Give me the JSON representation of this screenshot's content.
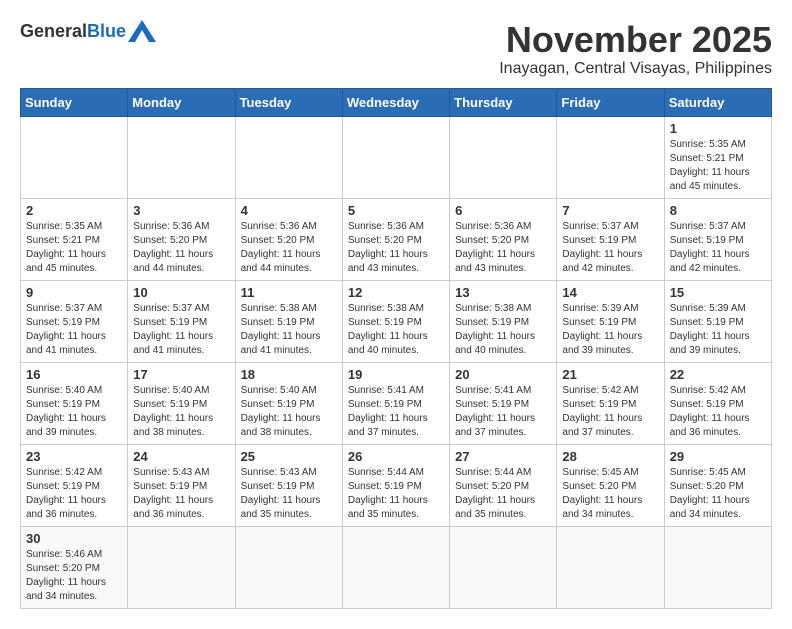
{
  "header": {
    "logo_general": "General",
    "logo_blue": "Blue",
    "month": "November 2025",
    "location": "Inayagan, Central Visayas, Philippines"
  },
  "weekdays": [
    "Sunday",
    "Monday",
    "Tuesday",
    "Wednesday",
    "Thursday",
    "Friday",
    "Saturday"
  ],
  "weeks": [
    [
      {
        "day": "",
        "info": ""
      },
      {
        "day": "",
        "info": ""
      },
      {
        "day": "",
        "info": ""
      },
      {
        "day": "",
        "info": ""
      },
      {
        "day": "",
        "info": ""
      },
      {
        "day": "",
        "info": ""
      },
      {
        "day": "1",
        "info": "Sunrise: 5:35 AM\nSunset: 5:21 PM\nDaylight: 11 hours\nand 45 minutes."
      }
    ],
    [
      {
        "day": "2",
        "info": "Sunrise: 5:35 AM\nSunset: 5:21 PM\nDaylight: 11 hours\nand 45 minutes."
      },
      {
        "day": "3",
        "info": "Sunrise: 5:36 AM\nSunset: 5:20 PM\nDaylight: 11 hours\nand 44 minutes."
      },
      {
        "day": "4",
        "info": "Sunrise: 5:36 AM\nSunset: 5:20 PM\nDaylight: 11 hours\nand 44 minutes."
      },
      {
        "day": "5",
        "info": "Sunrise: 5:36 AM\nSunset: 5:20 PM\nDaylight: 11 hours\nand 43 minutes."
      },
      {
        "day": "6",
        "info": "Sunrise: 5:36 AM\nSunset: 5:20 PM\nDaylight: 11 hours\nand 43 minutes."
      },
      {
        "day": "7",
        "info": "Sunrise: 5:37 AM\nSunset: 5:19 PM\nDaylight: 11 hours\nand 42 minutes."
      },
      {
        "day": "8",
        "info": "Sunrise: 5:37 AM\nSunset: 5:19 PM\nDaylight: 11 hours\nand 42 minutes."
      }
    ],
    [
      {
        "day": "9",
        "info": "Sunrise: 5:37 AM\nSunset: 5:19 PM\nDaylight: 11 hours\nand 41 minutes."
      },
      {
        "day": "10",
        "info": "Sunrise: 5:37 AM\nSunset: 5:19 PM\nDaylight: 11 hours\nand 41 minutes."
      },
      {
        "day": "11",
        "info": "Sunrise: 5:38 AM\nSunset: 5:19 PM\nDaylight: 11 hours\nand 41 minutes."
      },
      {
        "day": "12",
        "info": "Sunrise: 5:38 AM\nSunset: 5:19 PM\nDaylight: 11 hours\nand 40 minutes."
      },
      {
        "day": "13",
        "info": "Sunrise: 5:38 AM\nSunset: 5:19 PM\nDaylight: 11 hours\nand 40 minutes."
      },
      {
        "day": "14",
        "info": "Sunrise: 5:39 AM\nSunset: 5:19 PM\nDaylight: 11 hours\nand 39 minutes."
      },
      {
        "day": "15",
        "info": "Sunrise: 5:39 AM\nSunset: 5:19 PM\nDaylight: 11 hours\nand 39 minutes."
      }
    ],
    [
      {
        "day": "16",
        "info": "Sunrise: 5:40 AM\nSunset: 5:19 PM\nDaylight: 11 hours\nand 39 minutes."
      },
      {
        "day": "17",
        "info": "Sunrise: 5:40 AM\nSunset: 5:19 PM\nDaylight: 11 hours\nand 38 minutes."
      },
      {
        "day": "18",
        "info": "Sunrise: 5:40 AM\nSunset: 5:19 PM\nDaylight: 11 hours\nand 38 minutes."
      },
      {
        "day": "19",
        "info": "Sunrise: 5:41 AM\nSunset: 5:19 PM\nDaylight: 11 hours\nand 37 minutes."
      },
      {
        "day": "20",
        "info": "Sunrise: 5:41 AM\nSunset: 5:19 PM\nDaylight: 11 hours\nand 37 minutes."
      },
      {
        "day": "21",
        "info": "Sunrise: 5:42 AM\nSunset: 5:19 PM\nDaylight: 11 hours\nand 37 minutes."
      },
      {
        "day": "22",
        "info": "Sunrise: 5:42 AM\nSunset: 5:19 PM\nDaylight: 11 hours\nand 36 minutes."
      }
    ],
    [
      {
        "day": "23",
        "info": "Sunrise: 5:42 AM\nSunset: 5:19 PM\nDaylight: 11 hours\nand 36 minutes."
      },
      {
        "day": "24",
        "info": "Sunrise: 5:43 AM\nSunset: 5:19 PM\nDaylight: 11 hours\nand 36 minutes."
      },
      {
        "day": "25",
        "info": "Sunrise: 5:43 AM\nSunset: 5:19 PM\nDaylight: 11 hours\nand 35 minutes."
      },
      {
        "day": "26",
        "info": "Sunrise: 5:44 AM\nSunset: 5:19 PM\nDaylight: 11 hours\nand 35 minutes."
      },
      {
        "day": "27",
        "info": "Sunrise: 5:44 AM\nSunset: 5:20 PM\nDaylight: 11 hours\nand 35 minutes."
      },
      {
        "day": "28",
        "info": "Sunrise: 5:45 AM\nSunset: 5:20 PM\nDaylight: 11 hours\nand 34 minutes."
      },
      {
        "day": "29",
        "info": "Sunrise: 5:45 AM\nSunset: 5:20 PM\nDaylight: 11 hours\nand 34 minutes."
      }
    ],
    [
      {
        "day": "30",
        "info": "Sunrise: 5:46 AM\nSunset: 5:20 PM\nDaylight: 11 hours\nand 34 minutes."
      },
      {
        "day": "",
        "info": ""
      },
      {
        "day": "",
        "info": ""
      },
      {
        "day": "",
        "info": ""
      },
      {
        "day": "",
        "info": ""
      },
      {
        "day": "",
        "info": ""
      },
      {
        "day": "",
        "info": ""
      }
    ]
  ]
}
